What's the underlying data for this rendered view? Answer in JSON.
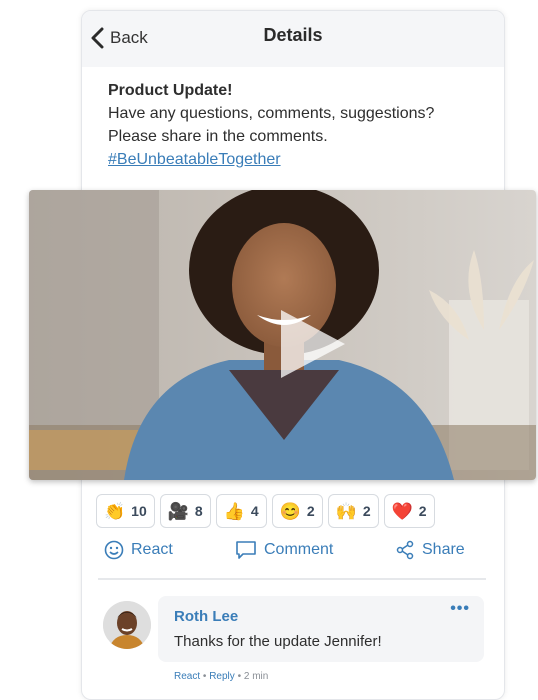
{
  "header": {
    "back_label": "Back",
    "title": "Details"
  },
  "post": {
    "title": "Product Update!",
    "body_line1": "Have any questions, comments, suggestions?",
    "body_line2": "Please share in the comments.",
    "hashtag": "#BeUnbeatableTogether"
  },
  "reactions": [
    {
      "icon": "clap-icon",
      "glyph": "👏",
      "count": "10"
    },
    {
      "icon": "video-camera-icon",
      "glyph": "🎥",
      "count": "8"
    },
    {
      "icon": "thumbs-up-icon",
      "glyph": "👍",
      "count": "4"
    },
    {
      "icon": "smile-icon",
      "glyph": "😊",
      "count": "2"
    },
    {
      "icon": "raised-hands-icon",
      "glyph": "🙌",
      "count": "2"
    },
    {
      "icon": "heart-icon",
      "glyph": "❤️",
      "count": "2"
    }
  ],
  "actions": {
    "react": "React",
    "comment": "Comment",
    "share": "Share"
  },
  "comment": {
    "author": "Roth Lee",
    "text": "Thanks for the update Jennifer!",
    "more": "•••",
    "react_link": "React",
    "reply_link": "Reply",
    "time": "2 min",
    "sep": "•"
  },
  "colors": {
    "accent": "#3a7db8",
    "nav_bg": "#f5f6f8"
  }
}
